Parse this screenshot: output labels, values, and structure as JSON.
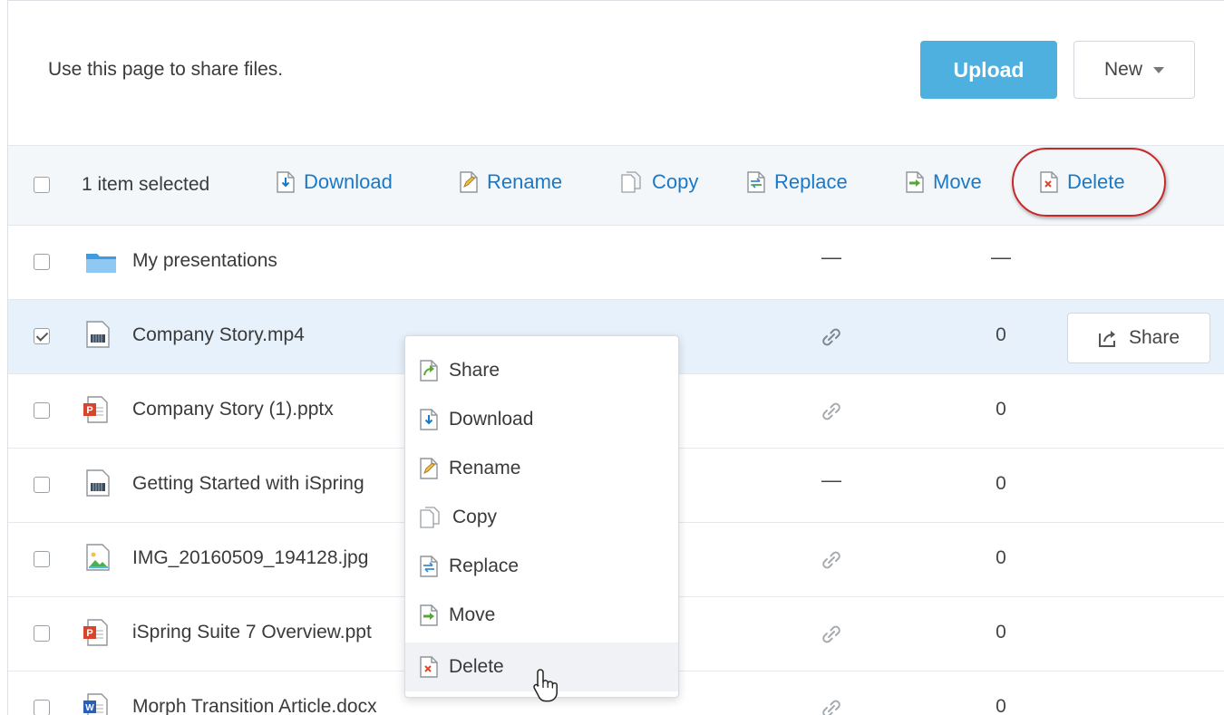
{
  "header": {
    "intro_text": "Use this page to share files.",
    "upload_label": "Upload",
    "new_label": "New"
  },
  "toolbar": {
    "selected_text": "1 item selected",
    "actions": {
      "download": "Download",
      "rename": "Rename",
      "copy": "Copy",
      "replace": "Replace",
      "move": "Move",
      "delete": "Delete"
    }
  },
  "files": [
    {
      "name": "My presentations",
      "type": "folder",
      "link": "—",
      "count": "—",
      "checked": false
    },
    {
      "name": "Company Story.mp4",
      "type": "video",
      "link": "link-icon",
      "count": "0",
      "checked": true,
      "share_label": "Share"
    },
    {
      "name": "Company Story (1).pptx",
      "type": "pptx",
      "link": "link-icon",
      "count": "0",
      "checked": false
    },
    {
      "name": "Getting Started with iSpring",
      "type": "video",
      "link": "—",
      "count": "0",
      "checked": false
    },
    {
      "name": "IMG_20160509_194128.jpg",
      "type": "image",
      "link": "link-icon",
      "count": "0",
      "checked": false
    },
    {
      "name": "iSpring Suite 7 Overview.ppt",
      "type": "pptx",
      "link": "link-icon",
      "count": "0",
      "checked": false
    },
    {
      "name": "Morph Transition Article.docx",
      "type": "docx",
      "link": "link-icon",
      "count": "0",
      "checked": false
    }
  ],
  "context_menu": {
    "items": [
      "Share",
      "Download",
      "Rename",
      "Copy",
      "Replace",
      "Move",
      "Delete"
    ],
    "hovered": "Delete"
  },
  "colors": {
    "accent": "#4db0de",
    "link": "#1a79c6",
    "selected_row": "#e6f1fb",
    "highlight_ring": "#c62828"
  }
}
